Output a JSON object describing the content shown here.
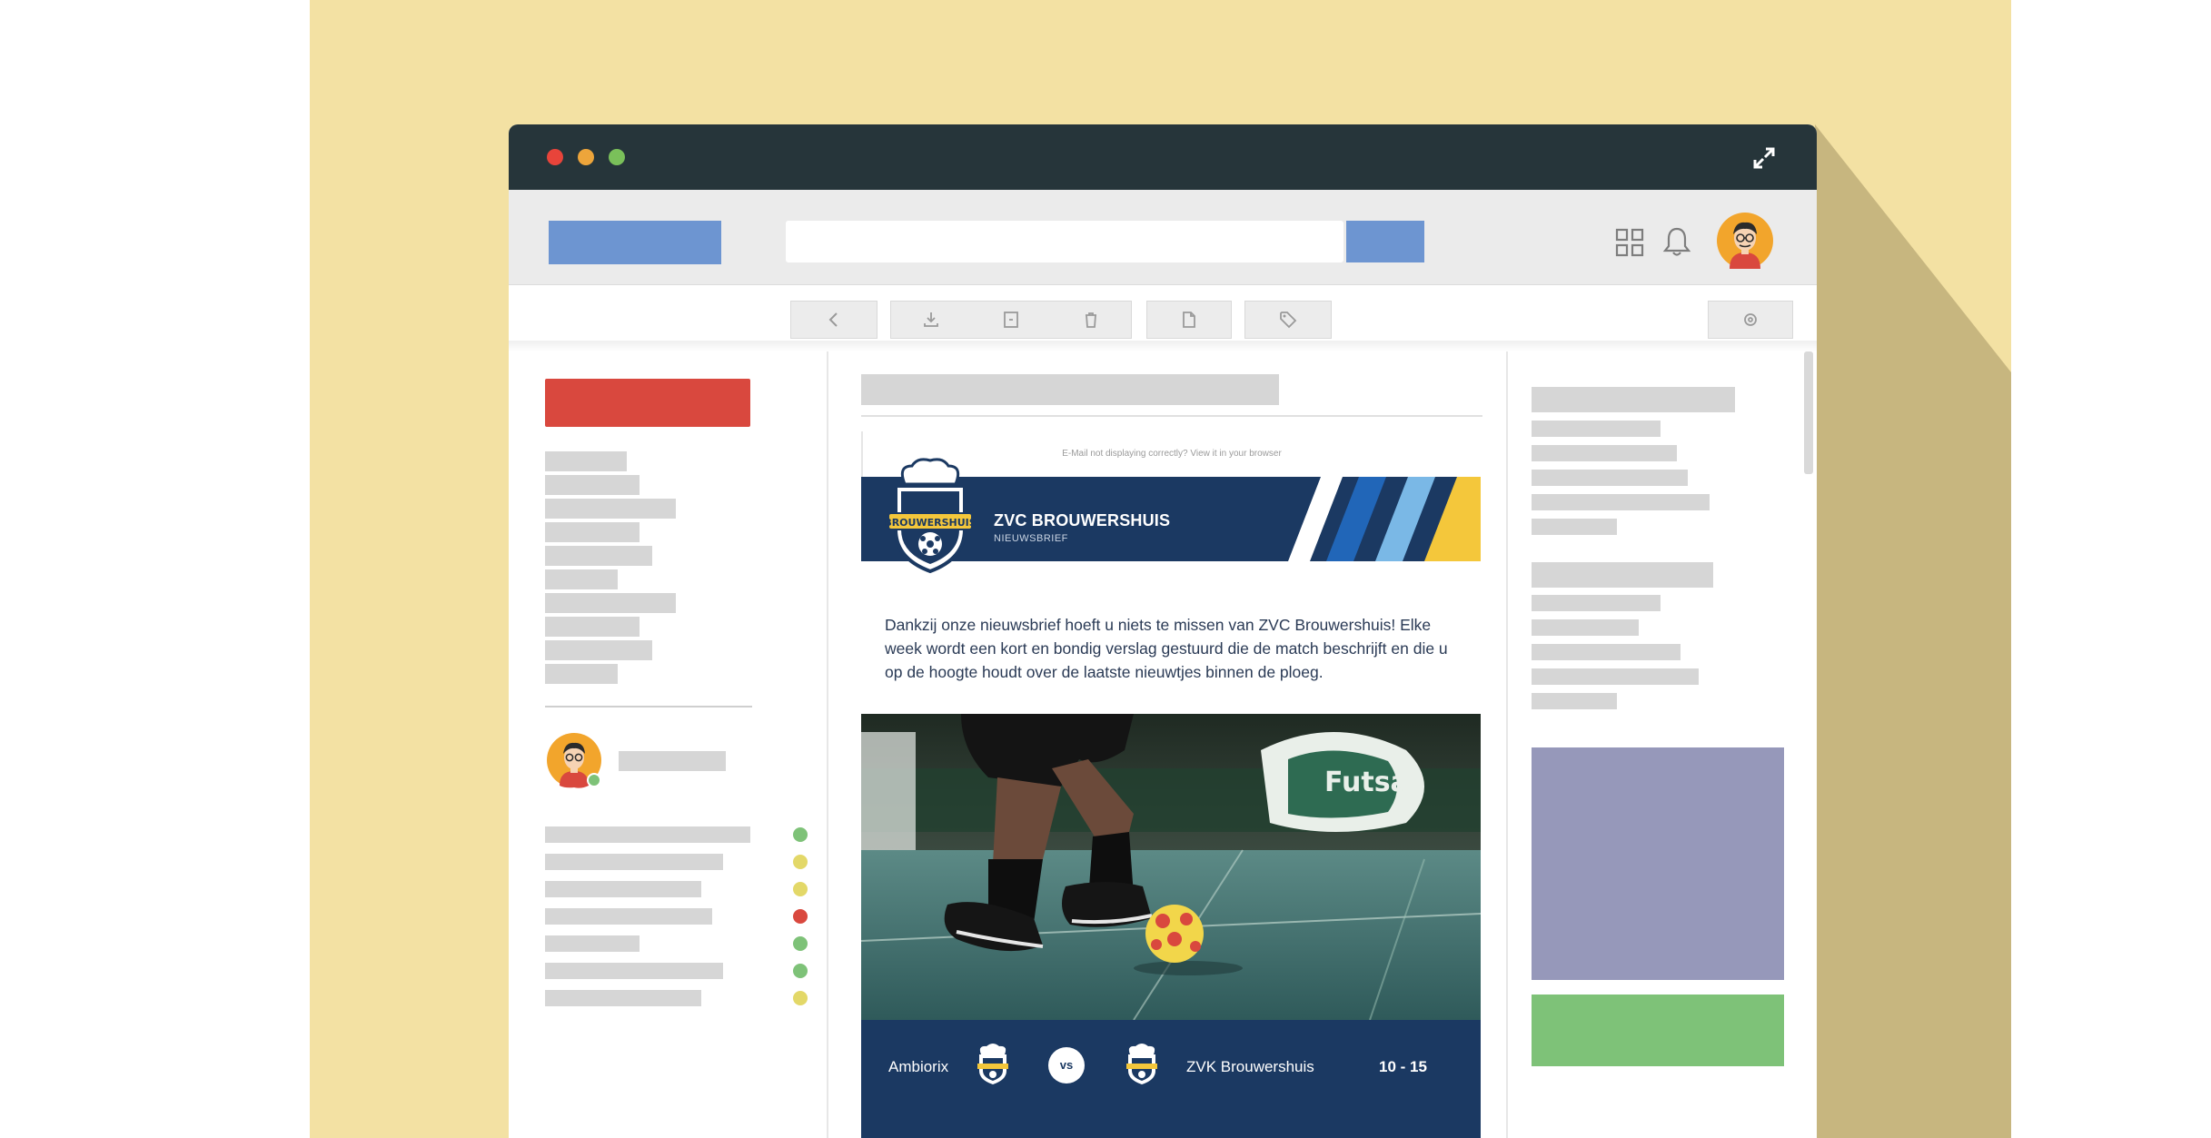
{
  "colors": {
    "backdrop": "#f3e1a3",
    "titlebar": "#26353a",
    "accent_blue": "#6d95d1",
    "compose_red": "#d9483e",
    "email_navy": "#1b3962",
    "status_green": "#7ec278",
    "status_yellow": "#e3d868",
    "status_red": "#d9483e"
  },
  "window": {
    "controls": [
      "close-dot",
      "minimize-dot",
      "maximize-dot"
    ],
    "expand_icon": "expand-icon"
  },
  "topbar": {
    "search_placeholder": "",
    "icons": [
      "apps-grid-icon",
      "bell-icon",
      "avatar"
    ]
  },
  "toolbar": {
    "buttons": [
      "back-icon",
      "download-icon",
      "archive-icon",
      "trash-icon",
      "document-icon",
      "tag-icon",
      "settings-icon"
    ]
  },
  "sidebar": {
    "contacts_status": [
      "online",
      "away",
      "away",
      "busy",
      "online",
      "online",
      "away"
    ]
  },
  "email": {
    "preheader": "E-Mail not displaying correctly? View it in your browser",
    "club_name": "ZVC BROUWERSHUIS",
    "club_subtitle": "NIEUWSBRIEF",
    "logo_text": "BROUWERSHUIS",
    "intro": "Dankzij onze nieuwsbrief hoeft u niets te missen van ZVC Brouwershuis! Elke week wordt een kort en bondig verslag gestuurd die de match beschrijft en die u op de hoogte houdt over de laatste nieuwtjes binnen de ploeg.",
    "photo_banner": "Futsal",
    "match": {
      "home_team": "Ambiorix",
      "vs": "vs",
      "away_team": "ZVK Brouwershuis",
      "score": "10 - 15"
    }
  }
}
